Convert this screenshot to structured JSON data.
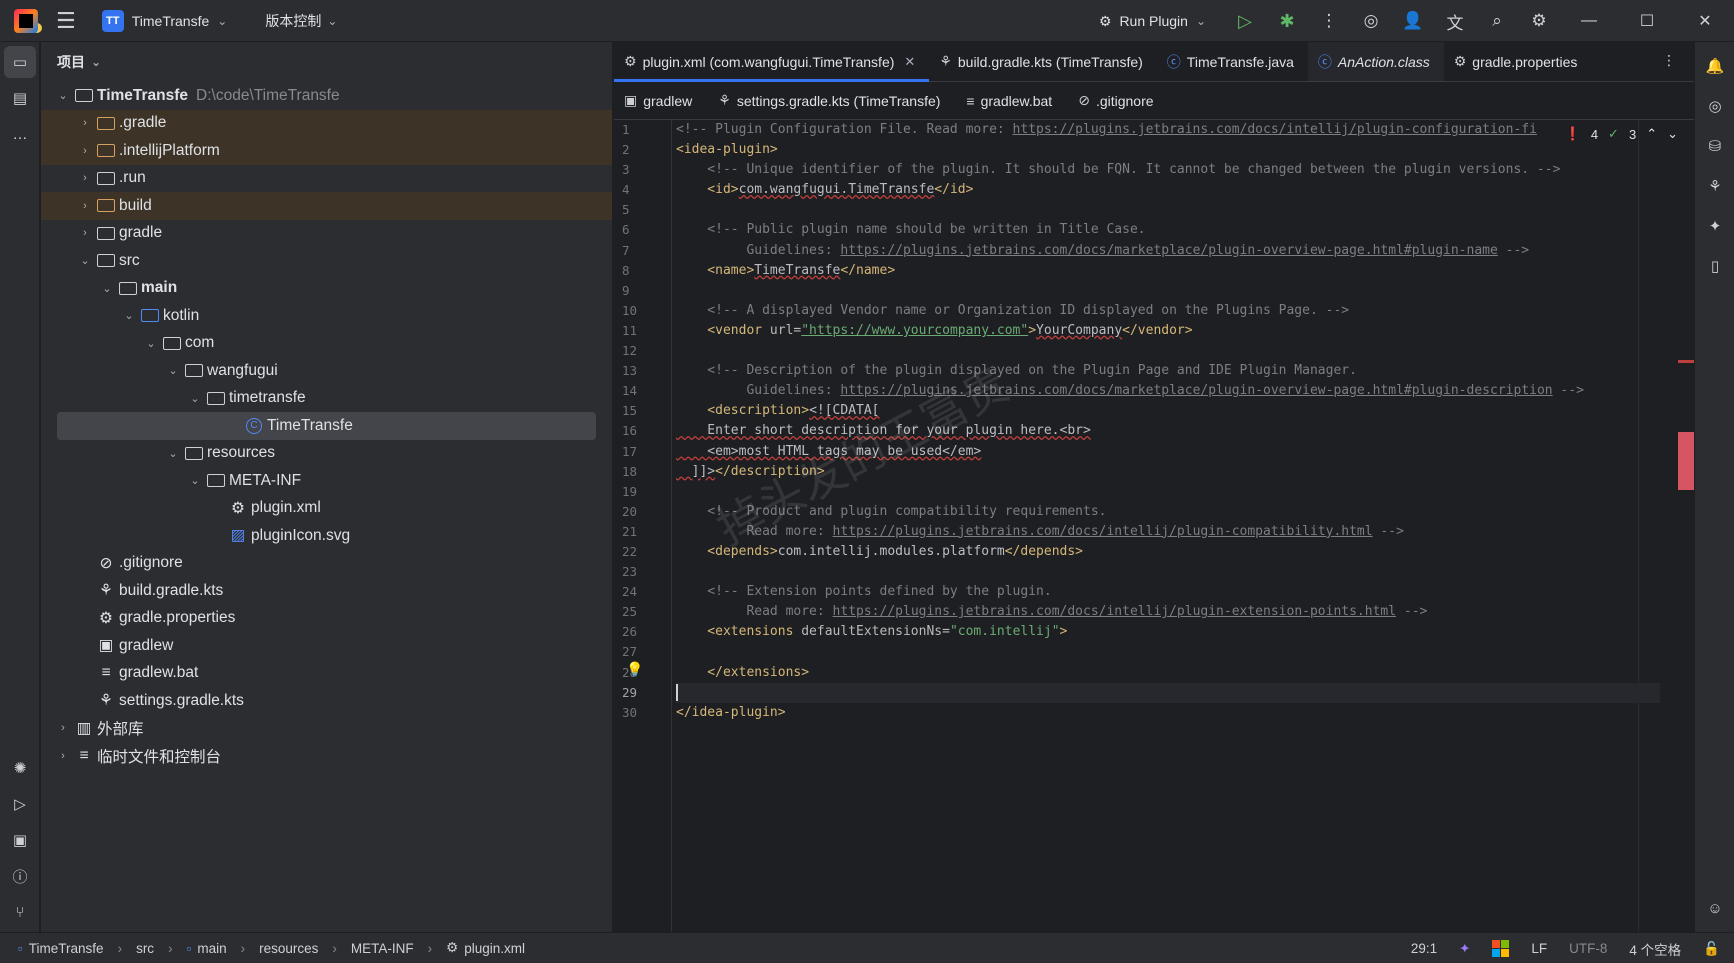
{
  "titlebar": {
    "project_badge": "TT",
    "project_name": "TimeTransfe",
    "vcs_label": "版本控制",
    "run_config": "Run Plugin"
  },
  "project_panel": {
    "title": "项目",
    "root_name": "TimeTransfe",
    "root_path": "D:\\code\\TimeTransfe",
    "items": [
      {
        "label": ".gradle"
      },
      {
        "label": ".intellijPlatform"
      },
      {
        "label": ".run"
      },
      {
        "label": "build"
      },
      {
        "label": "gradle"
      },
      {
        "label": "src"
      },
      {
        "label": "main"
      },
      {
        "label": "kotlin"
      },
      {
        "label": "com"
      },
      {
        "label": "wangfugui"
      },
      {
        "label": "timetransfe"
      },
      {
        "label": "TimeTransfe"
      },
      {
        "label": "resources"
      },
      {
        "label": "META-INF"
      },
      {
        "label": "plugin.xml"
      },
      {
        "label": "pluginIcon.svg"
      },
      {
        "label": ".gitignore"
      },
      {
        "label": "build.gradle.kts"
      },
      {
        "label": "gradle.properties"
      },
      {
        "label": "gradlew"
      },
      {
        "label": "gradlew.bat"
      },
      {
        "label": "settings.gradle.kts"
      },
      {
        "label": "外部库"
      },
      {
        "label": "临时文件和控制台"
      }
    ]
  },
  "tabs": [
    {
      "label": "plugin.xml (com.wangfugui.TimeTransfe)"
    },
    {
      "label": "build.gradle.kts (TimeTransfe)"
    },
    {
      "label": "TimeTransfe.java"
    },
    {
      "label": "AnAction.class"
    },
    {
      "label": "gradle.properties"
    }
  ],
  "tabs_row2": [
    {
      "label": "gradlew"
    },
    {
      "label": "settings.gradle.kts (TimeTransfe)"
    },
    {
      "label": "gradlew.bat"
    },
    {
      "label": ".gitignore"
    }
  ],
  "inspections": {
    "errors": "4",
    "warnings": "3"
  },
  "line_numbers": [
    "1",
    "2",
    "3",
    "4",
    "5",
    "6",
    "7",
    "8",
    "9",
    "10",
    "11",
    "12",
    "13",
    "14",
    "15",
    "16",
    "17",
    "18",
    "19",
    "20",
    "21",
    "22",
    "23",
    "24",
    "25",
    "26",
    "27",
    "28",
    "29",
    "30"
  ],
  "code": {
    "l1_comment": "<!-- Plugin Configuration File. Read more: ",
    "l1_link": "https://plugins.jetbrains.com/docs/intellij/plugin-configuration-fi",
    "l2": "<idea-plugin>",
    "l3": "    <!-- Unique identifier of the plugin. It should be FQN. It cannot be changed between the plugin versions. -->",
    "l4_open": "    <id>",
    "l4_val": "com.wangfugui.TimeTransfe",
    "l4_close": "</id>",
    "l6": "    <!-- Public plugin name should be written in Title Case.",
    "l7_pre": "         Guidelines: ",
    "l7_link": "https://plugins.jetbrains.com/docs/marketplace/plugin-overview-page.html#plugin-name",
    "l7_post": " -->",
    "l8_open": "    <name>",
    "l8_val": "TimeTransfe",
    "l8_close": "</name>",
    "l10": "    <!-- A displayed Vendor name or Organization ID displayed on the Plugins Page. -->",
    "l11_open": "    <vendor ",
    "l11_attr": "url=",
    "l11_str": "\"https://www.yourcompany.com\"",
    "l11_gt": ">",
    "l11_val": "YourCompany",
    "l11_close": "</vendor>",
    "l13": "    <!-- Description of the plugin displayed on the Plugin Page and IDE Plugin Manager.",
    "l14_pre": "         Guidelines: ",
    "l14_link": "https://plugins.jetbrains.com/docs/marketplace/plugin-overview-page.html#plugin-description",
    "l14_post": " -->",
    "l15_open": "    <description>",
    "l15_cdata": "<![CDATA[",
    "l16": "    Enter short description for your plugin here.<br>",
    "l17": "    <em>most HTML tags may be used</em>",
    "l18_pre": "  ]]>",
    "l18_close": "</description>",
    "l20": "    <!-- Product and plugin compatibility requirements.",
    "l21_pre": "         Read more: ",
    "l21_link": "https://plugins.jetbrains.com/docs/intellij/plugin-compatibility.html",
    "l21_post": " -->",
    "l22_open": "    <depends>",
    "l22_val": "com.intellij.modules.platform",
    "l22_close": "</depends>",
    "l24": "    <!-- Extension points defined by the plugin.",
    "l25_pre": "         Read more: ",
    "l25_link": "https://plugins.jetbrains.com/docs/intellij/plugin-extension-points.html",
    "l25_post": " -->",
    "l26_open": "    <extensions ",
    "l26_attr": "defaultExtensionNs=",
    "l26_str": "\"com.intellij\"",
    "l26_gt": ">",
    "l28": "    </extensions>",
    "l30": "</idea-plugin>"
  },
  "watermark": "掉头发的王富贵",
  "statusbar": {
    "crumbs": [
      "TimeTransfe",
      "src",
      "main",
      "resources",
      "META-INF",
      "plugin.xml"
    ],
    "position": "29:1",
    "line_sep": "LF",
    "encoding": "UTF-8",
    "indent": "4 个空格"
  },
  "colors": {
    "accent": "#3574f0",
    "error": "#e55d5d",
    "ok": "#5fb865"
  }
}
